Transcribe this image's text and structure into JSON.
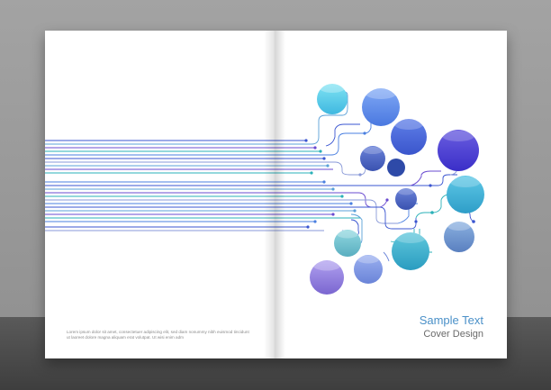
{
  "cover": {
    "title": "Sample Text",
    "subtitle": "Cover Design",
    "body_copy": "Lorem ipsum dolor sit amet, consectetuer adipiscing elit, sed diam nonummy nibh euismod tincidunt ut laoreet dolore magna aliquam erat volutpat. Ut wisi enim adm"
  },
  "colors": {
    "background": "#9b9b9b",
    "floor": "#4a4a4a",
    "page": "#ffffff",
    "title": "#4a90c8",
    "subtitle": "#6a6a6a",
    "line_palette": [
      "#3a55d0",
      "#5aa0d8",
      "#6a4bd0",
      "#2ab0b8",
      "#4a7fe0",
      "#8a9ad8"
    ]
  }
}
